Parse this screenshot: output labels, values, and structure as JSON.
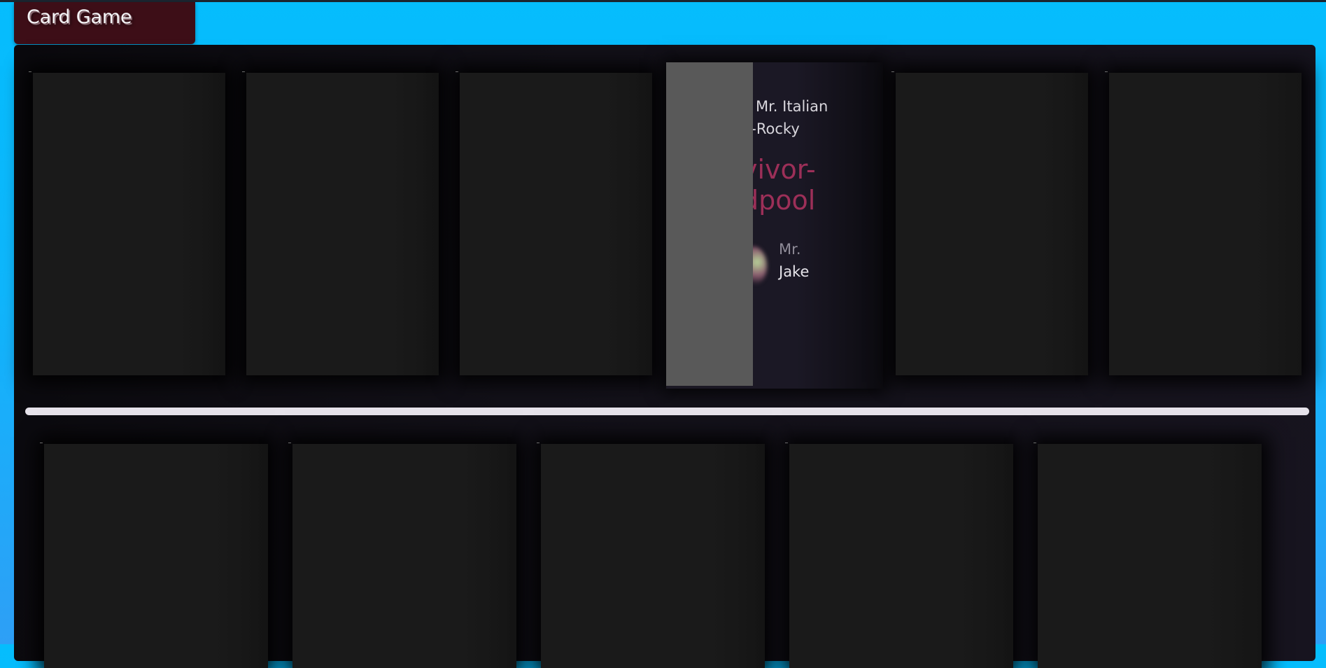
{
  "app": {
    "title": "Card Game"
  },
  "board": {
    "top_row_face_down_cards": 5,
    "bottom_row_face_down_cards": 5
  },
  "flipped_card": {
    "line1": "u Mr. Italian",
    "line2": "n-Rocky",
    "name_line1": "vivor-",
    "name_line2": "dpool",
    "user_prefix": "Mr.",
    "user_name": "Jake"
  },
  "colors": {
    "background": "#05bdfd",
    "title_tab": "#3d0e17",
    "board": "#121018",
    "card_back": "#1a1a1a",
    "flip_panel": "#595959",
    "accent_name": "#9c2f58",
    "divider": "#e6e2ea"
  }
}
